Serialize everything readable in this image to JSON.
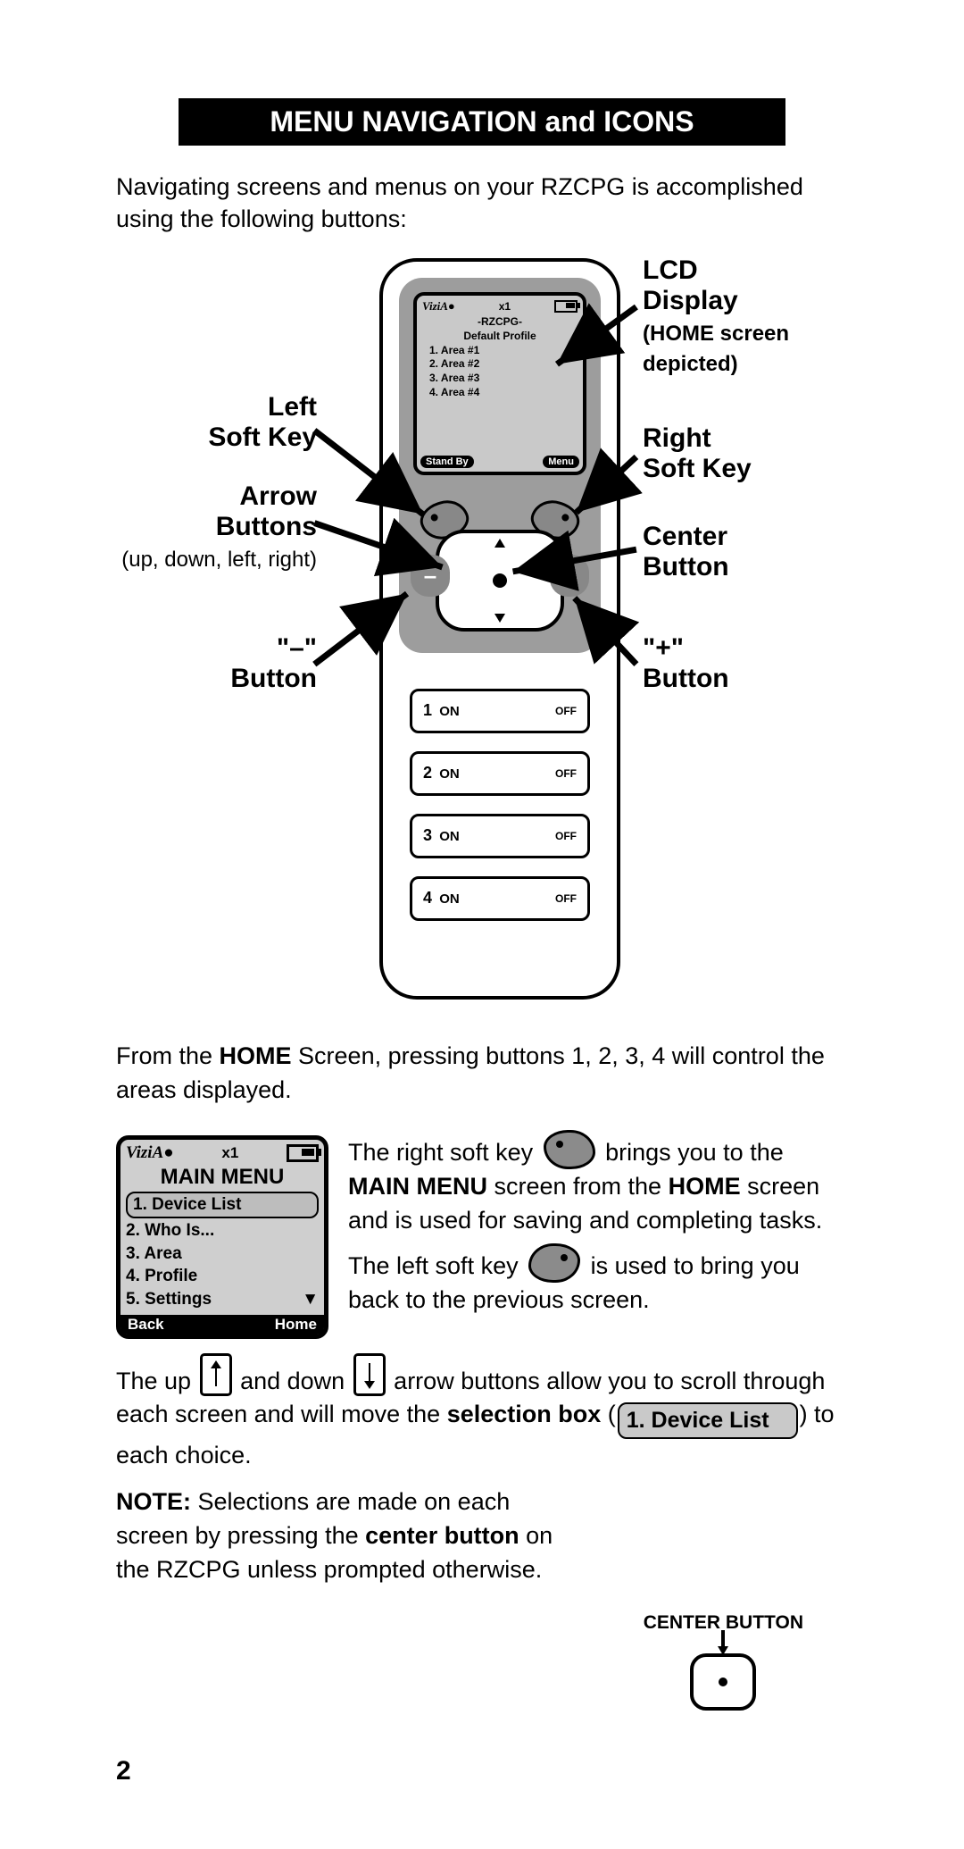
{
  "title_bar": "MENU NAVIGATION and ICONS",
  "intro": "Navigating screens and menus on your RZCPG is accomplished using the following buttons:",
  "labels": {
    "lcd1": "LCD",
    "lcd2": "Display",
    "lcd_sub": "(HOME screen depicted)",
    "rsk1": "Right",
    "rsk2": "Soft Key",
    "center1": "Center",
    "center2": "Button",
    "plus1": "\"+\"",
    "plus2": "Button",
    "lsk1": "Left",
    "lsk2": "Soft Key",
    "arrow1": "Arrow",
    "arrow2": "Buttons",
    "arrow_sub": "(up, down, left, right)",
    "minus1": "\"–\"",
    "minus2": "Button"
  },
  "remote_lcd": {
    "brand": "ViziA●",
    "mult": "x1",
    "subtitle": "-RZCPG-",
    "profile": "Default Profile",
    "a1": "1. Area #1",
    "a2": "2. Area #2",
    "a3": "3. Area #3",
    "a4": "4. Area #4",
    "foot_left": "Stand By",
    "foot_right": "Menu"
  },
  "dpad": {
    "minus": "–",
    "plus": "+"
  },
  "rows": {
    "on": "ON",
    "off": "OFF",
    "n1": "1",
    "n2": "2",
    "n3": "3",
    "n4": "4"
  },
  "para2a": "From the ",
  "para2b": "HOME",
  "para2c": " Screen, pressing buttons 1, 2, 3, 4 will control the areas displayed.",
  "mini": {
    "brand": "ViziA●",
    "mult": "x1",
    "title": "MAIN MENU",
    "i1": "1. Device List",
    "i2": "2. Who Is...",
    "i3": "3. Area",
    "i4": "4. Profile",
    "i5": "5. Settings",
    "tri": "▼",
    "back": "Back",
    "home": "Home"
  },
  "p_rsk_a": "The right soft key ",
  "p_rsk_b": " brings you to the ",
  "p_rsk_c": "MAIN MENU",
  "p_rsk_d": " screen from the ",
  "p_rsk_e": "HOME",
  "p_rsk_f": " screen and is used for saving and completing tasks.",
  "p_lsk_a": "The left soft key ",
  "p_lsk_b": " is used to bring you back to the previous screen.",
  "p_arr_a": "The up ",
  "p_arr_b": " and down ",
  "p_arr_c": " arrow buttons allow you to scroll through each screen and will move the ",
  "p_arr_d": "selection box",
  "p_arr_e": " (",
  "p_arr_sel": "1. Device List",
  "p_arr_f": ") to each choice.",
  "p_note_a": "NOTE:",
  "p_note_b": " Selections are made on each screen by pressing the ",
  "p_note_c": "center button",
  "p_note_d": " on the RZCPG unless prompted otherwise.",
  "cb_label": "CENTER BUTTON",
  "page_number": "2"
}
